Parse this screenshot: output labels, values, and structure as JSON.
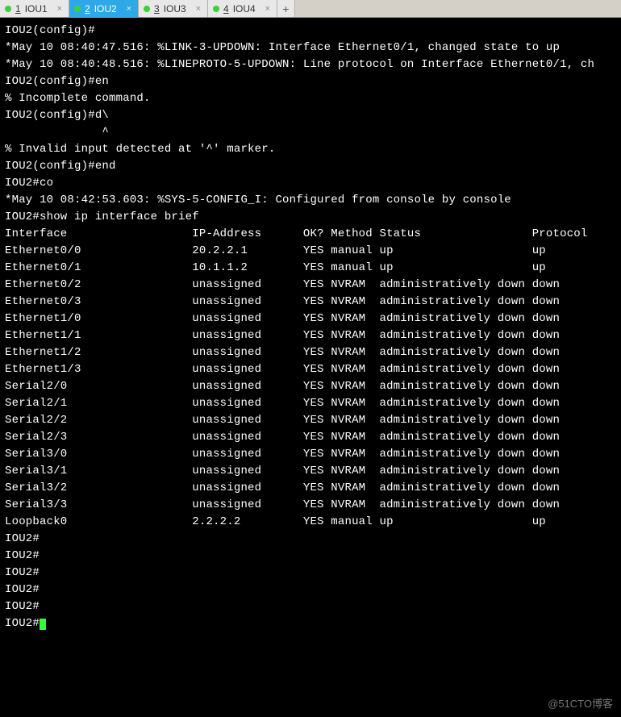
{
  "tabs": [
    {
      "num": "1",
      "label": "IOU1",
      "active": false
    },
    {
      "num": "2",
      "label": "IOU2",
      "active": true
    },
    {
      "num": "3",
      "label": "IOU3",
      "active": false
    },
    {
      "num": "4",
      "label": "IOU4",
      "active": false
    }
  ],
  "lines_pre": [
    "IOU2(config)#",
    "*May 10 08:40:47.516: %LINK-3-UPDOWN: Interface Ethernet0/1, changed state to up",
    "*May 10 08:40:48.516: %LINEPROTO-5-UPDOWN: Line protocol on Interface Ethernet0/1, ch",
    "IOU2(config)#en",
    "% Incomplete command.",
    "",
    "IOU2(config)#d\\",
    "              ^",
    "% Invalid input detected at '^' marker.",
    "",
    "IOU2(config)#end",
    "IOU2#co",
    "*May 10 08:42:53.603: %SYS-5-CONFIG_I: Configured from console by console",
    "IOU2#show ip interface brief"
  ],
  "table_header": {
    "iface": "Interface",
    "ip": "IP-Address",
    "ok": "OK?",
    "method": "Method",
    "status": "Status",
    "proto": "Protocol"
  },
  "rows": [
    {
      "iface": "Ethernet0/0",
      "ip": "20.2.2.1",
      "ok": "YES",
      "method": "manual",
      "status": "up",
      "proto": "up"
    },
    {
      "iface": "Ethernet0/1",
      "ip": "10.1.1.2",
      "ok": "YES",
      "method": "manual",
      "status": "up",
      "proto": "up"
    },
    {
      "iface": "Ethernet0/2",
      "ip": "unassigned",
      "ok": "YES",
      "method": "NVRAM",
      "status": "administratively down",
      "proto": "down"
    },
    {
      "iface": "Ethernet0/3",
      "ip": "unassigned",
      "ok": "YES",
      "method": "NVRAM",
      "status": "administratively down",
      "proto": "down"
    },
    {
      "iface": "Ethernet1/0",
      "ip": "unassigned",
      "ok": "YES",
      "method": "NVRAM",
      "status": "administratively down",
      "proto": "down"
    },
    {
      "iface": "Ethernet1/1",
      "ip": "unassigned",
      "ok": "YES",
      "method": "NVRAM",
      "status": "administratively down",
      "proto": "down"
    },
    {
      "iface": "Ethernet1/2",
      "ip": "unassigned",
      "ok": "YES",
      "method": "NVRAM",
      "status": "administratively down",
      "proto": "down"
    },
    {
      "iface": "Ethernet1/3",
      "ip": "unassigned",
      "ok": "YES",
      "method": "NVRAM",
      "status": "administratively down",
      "proto": "down"
    },
    {
      "iface": "Serial2/0",
      "ip": "unassigned",
      "ok": "YES",
      "method": "NVRAM",
      "status": "administratively down",
      "proto": "down"
    },
    {
      "iface": "Serial2/1",
      "ip": "unassigned",
      "ok": "YES",
      "method": "NVRAM",
      "status": "administratively down",
      "proto": "down"
    },
    {
      "iface": "Serial2/2",
      "ip": "unassigned",
      "ok": "YES",
      "method": "NVRAM",
      "status": "administratively down",
      "proto": "down"
    },
    {
      "iface": "Serial2/3",
      "ip": "unassigned",
      "ok": "YES",
      "method": "NVRAM",
      "status": "administratively down",
      "proto": "down"
    },
    {
      "iface": "Serial3/0",
      "ip": "unassigned",
      "ok": "YES",
      "method": "NVRAM",
      "status": "administratively down",
      "proto": "down"
    },
    {
      "iface": "Serial3/1",
      "ip": "unassigned",
      "ok": "YES",
      "method": "NVRAM",
      "status": "administratively down",
      "proto": "down"
    },
    {
      "iface": "Serial3/2",
      "ip": "unassigned",
      "ok": "YES",
      "method": "NVRAM",
      "status": "administratively down",
      "proto": "down"
    },
    {
      "iface": "Serial3/3",
      "ip": "unassigned",
      "ok": "YES",
      "method": "NVRAM",
      "status": "administratively down",
      "proto": "down"
    },
    {
      "iface": "Loopback0",
      "ip": "2.2.2.2",
      "ok": "YES",
      "method": "manual",
      "status": "up",
      "proto": "up"
    }
  ],
  "lines_post": [
    "IOU2#",
    "IOU2#",
    "IOU2#",
    "IOU2#",
    "IOU2#"
  ],
  "prompt_final": "IOU2#",
  "watermark": "@51CTO博客",
  "close_glyph": "×",
  "add_glyph": "+"
}
